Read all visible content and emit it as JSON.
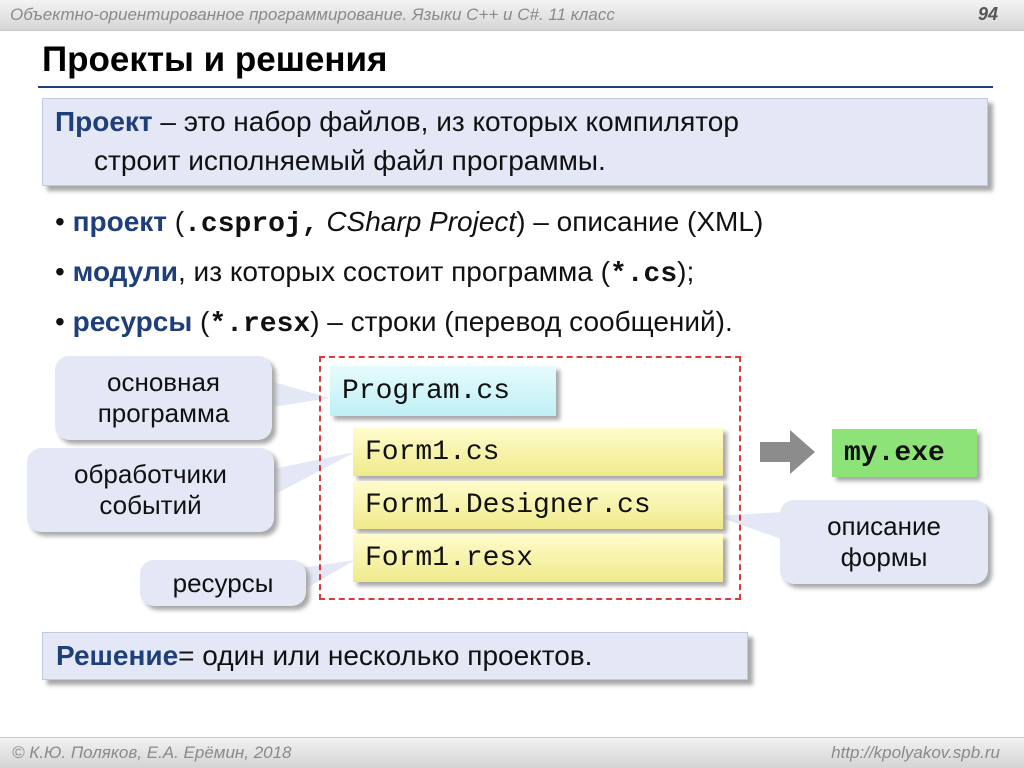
{
  "header": {
    "course": "Объектно-ориентированное программирование. Языки C++ и C#. 11 класс",
    "page_number": "94"
  },
  "title": "Проекты и решения",
  "definition": {
    "term": "Проект",
    "text_line1": " – это набор файлов, из которых компилятор",
    "text_line2": "строит исполняемый файл программы."
  },
  "bullets": [
    {
      "mark": "•",
      "term": "проект",
      "p1": " (",
      "code": ".csproj,",
      "italic": " CSharp Project",
      "p2": ") – описание (XML)"
    },
    {
      "mark": "•",
      "term": "модули",
      "p1": ", из которых состоит программа (",
      "code": "*.cs",
      "p2": ");"
    },
    {
      "mark": "•",
      "term": "ресурсы",
      "p1": " (",
      "code": "*.resx",
      "p2": ") – строки (перевод сообщений)."
    }
  ],
  "callouts": {
    "main_program": [
      "основная",
      "программа"
    ],
    "event_handlers": [
      "обработчики",
      "событий"
    ],
    "resources": "ресурсы",
    "form_description": [
      "описание",
      "формы"
    ]
  },
  "files": {
    "program": "Program.cs",
    "form1": "Form1.cs",
    "designer": "Form1.Designer.cs",
    "resx": "Form1.resx"
  },
  "output": "my.exe",
  "solution": {
    "term": "Решение",
    "text": " = один или несколько проектов."
  },
  "footer": {
    "copyright": "© К.Ю. Поляков, Е.А. Ерёмин, 2018",
    "url": "http://kpolyakov.spb.ru"
  },
  "colors": {
    "accent": "#1f3f7a",
    "callout_bg": "#e4e7f6",
    "dashed_border": "#d93c3c",
    "exe_green": "#8de377"
  }
}
